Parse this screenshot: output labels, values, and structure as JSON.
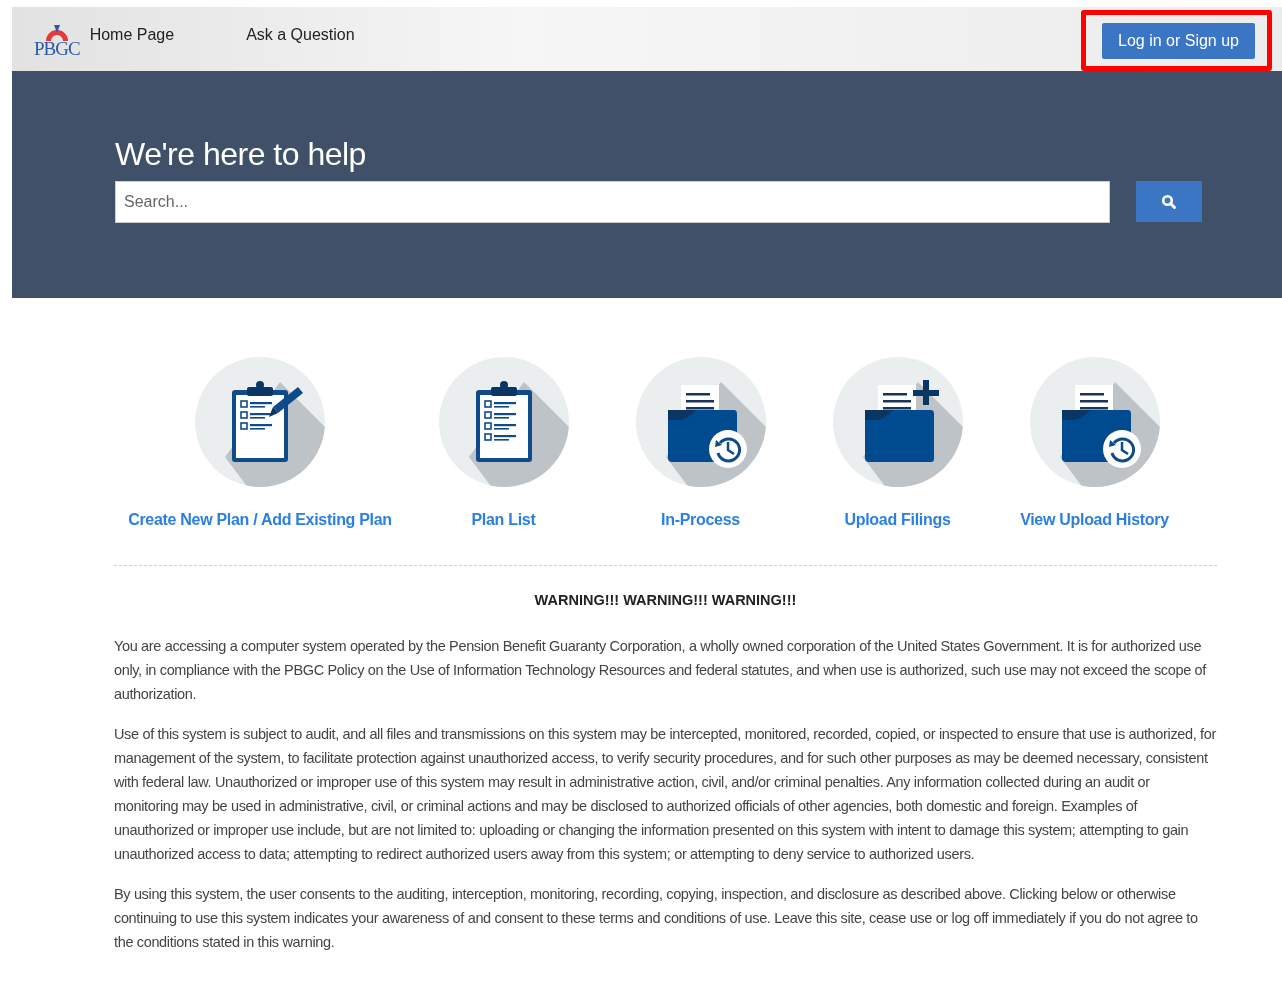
{
  "nav": {
    "logo": "PBGC",
    "links": [
      {
        "label": "Home Page"
      },
      {
        "label": "Ask a Question"
      }
    ],
    "login": {
      "label": "Log in or Sign up",
      "highlighted": true
    }
  },
  "hero": {
    "title": "We're here to help",
    "search": {
      "placeholder": "Search..."
    }
  },
  "tiles": [
    {
      "kind": "clipboard-pen",
      "label": "Create New Plan / Add Existing Plan"
    },
    {
      "kind": "clipboard-list",
      "label": "Plan List"
    },
    {
      "kind": "folder-clock",
      "label": "In-Process"
    },
    {
      "kind": "folder-plus",
      "label": "Upload Filings"
    },
    {
      "kind": "folder-clock",
      "label": "View Upload History"
    }
  ],
  "warning": {
    "title": "WARNING!!! WARNING!!! WARNING!!!",
    "paragraphs": [
      "You are accessing a computer system operated by the Pension Benefit Guaranty Corporation, a wholly owned corporation of the United States Government. It is for authorized use only, in compliance with the PBGC Policy on the Use of Information Technology Resources and federal statutes, and when use is authorized, such use may not exceed the scope of authorization.",
      "Use of this system is subject to audit, and all files and transmissions on this system may be intercepted, monitored, recorded, copied, or inspected to ensure that use is authorized, for management of the system, to facilitate protection against unauthorized access, to verify security procedures, and for such other purposes as may be deemed necessary, consistent with federal law. Unauthorized or improper use of this system may result in administrative action, civil, and/or criminal penalties. Any information collected during an audit or monitoring may be used in administrative, civil, or criminal actions and may be disclosed to authorized officials of other agencies, both domestic and foreign. Examples of unauthorized or improper use include, but are not limited to: uploading or changing the information presented on this system with intent to damage this system; attempting to gain unauthorized access to data; attempting to redirect authorized users away from this system; or attempting to deny service to authorized users.",
      "By using this system, the user consents to the auditing, interception, monitoring, recording, copying, inspection, and disclosure as described above. Clicking below or otherwise continuing to use this system indicates your awareness of and consent to these terms and conditions of use. Leave this site, cease use or log off immediately if you do not agree to the conditions stated in this warning."
    ]
  }
}
